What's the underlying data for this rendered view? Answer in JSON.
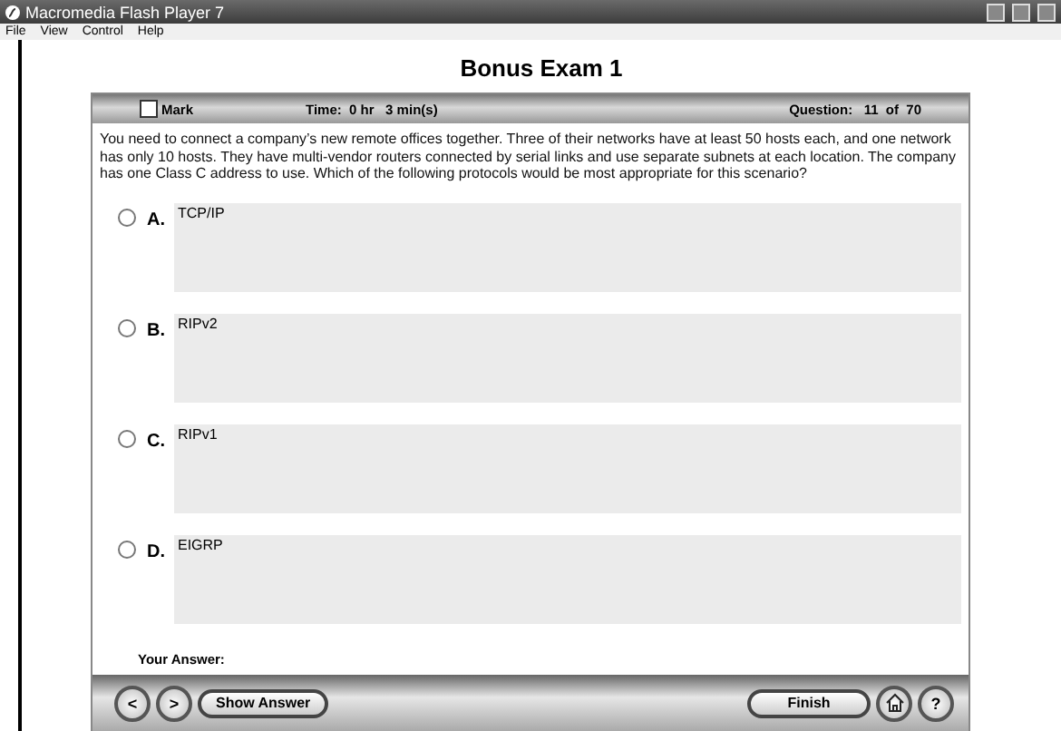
{
  "window": {
    "title": "Macromedia Flash Player 7"
  },
  "menu": [
    "File",
    "View",
    "Control",
    "Help"
  ],
  "exam": {
    "title": "Bonus Exam 1",
    "mark": {
      "label": "Mark",
      "checked": false
    },
    "time": "Time:  0 hr   3 min(s)",
    "question_no": "Question:   11  of  70"
  },
  "question": "You need to connect a company’s new remote offices together. Three of their networks have at least 50 hosts each, and one network has only 10 hosts. They have multi-vendor routers connected by serial links and use separate subnets at each location. The company has one Class C address to use. Which of the following protocols would be most appropriate for this scenario?",
  "options": [
    {
      "letter": "A.",
      "text": "TCP/IP",
      "selected": false
    },
    {
      "letter": "B.",
      "text": "RIPv2",
      "selected": false
    },
    {
      "letter": "C.",
      "text": "RIPv1",
      "selected": false
    },
    {
      "letter": "D.",
      "text": "EIGRP",
      "selected": false
    }
  ],
  "your_answer": "Your Answer:",
  "footer": {
    "prev": "<",
    "next": ">",
    "show_answer": "Show Answer",
    "finish": "Finish",
    "help": "?"
  }
}
